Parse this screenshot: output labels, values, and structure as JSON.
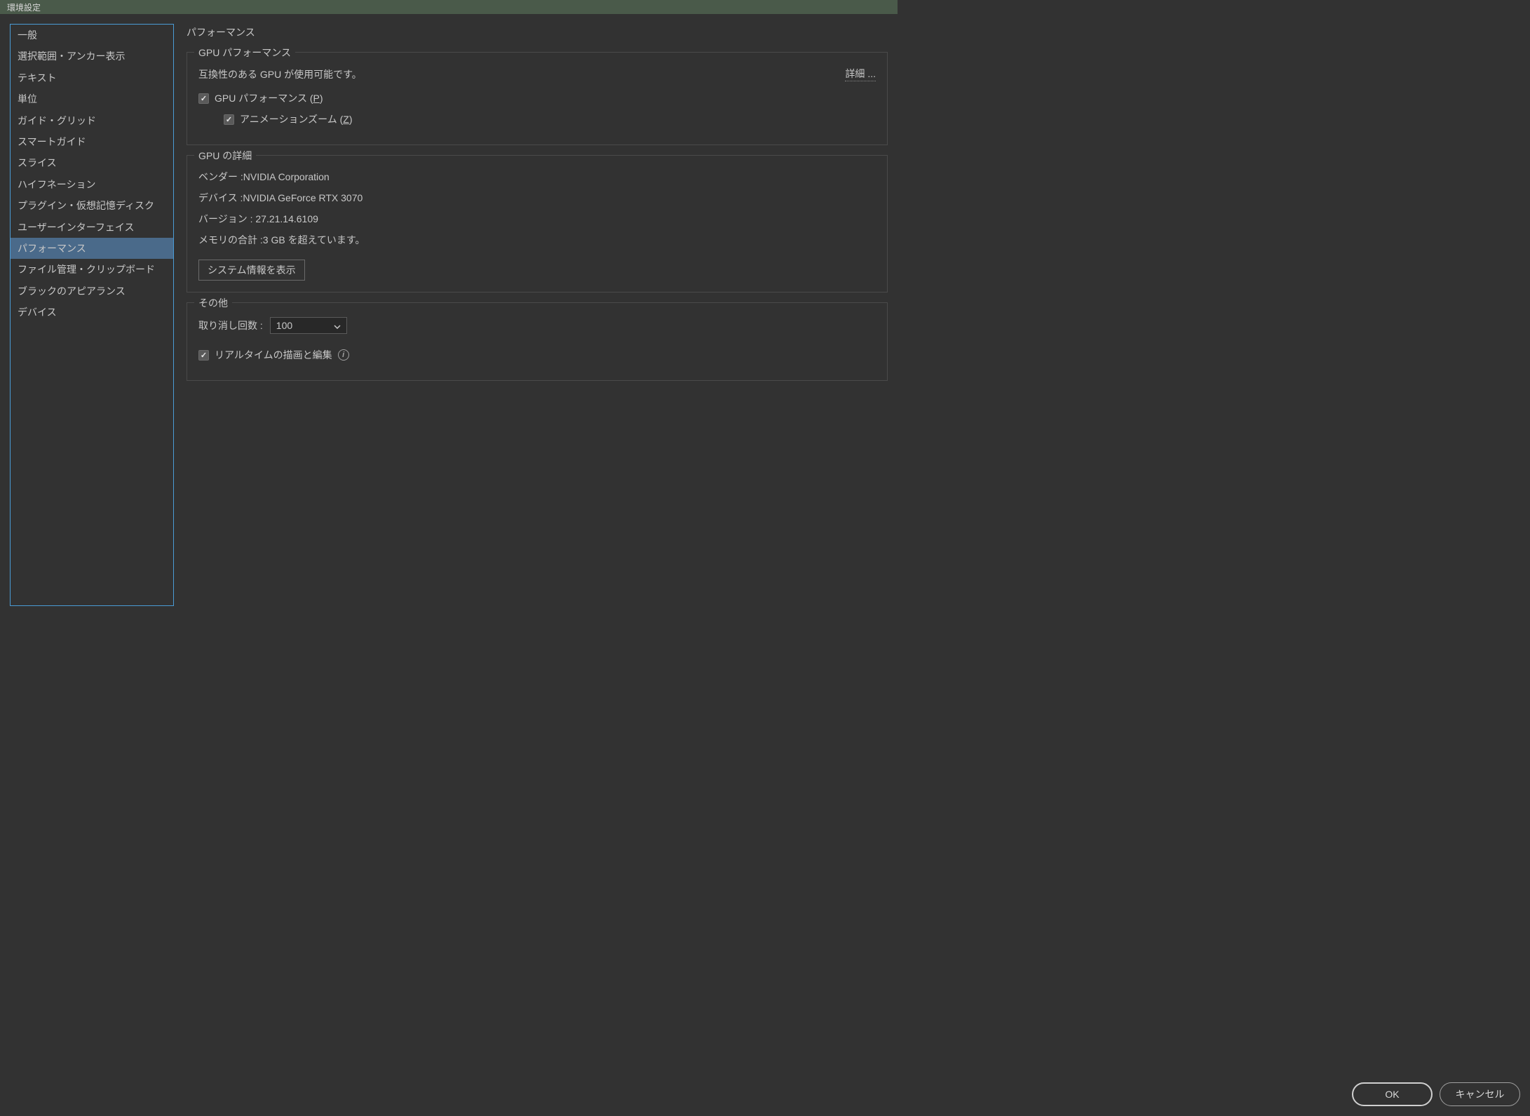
{
  "title_bar": "環境設定",
  "sidebar": {
    "items": [
      {
        "label": "一般"
      },
      {
        "label": "選択範囲・アンカー表示"
      },
      {
        "label": "テキスト"
      },
      {
        "label": "単位"
      },
      {
        "label": "ガイド・グリッド"
      },
      {
        "label": "スマートガイド"
      },
      {
        "label": "スライス"
      },
      {
        "label": "ハイフネーション"
      },
      {
        "label": "プラグイン・仮想記憶ディスク"
      },
      {
        "label": "ユーザーインターフェイス"
      },
      {
        "label": "パフォーマンス"
      },
      {
        "label": "ファイル管理・クリップボード"
      },
      {
        "label": "ブラックのアピアランス"
      },
      {
        "label": "デバイス"
      }
    ],
    "selected_index": 10
  },
  "main": {
    "page_title": "パフォーマンス",
    "gpu_perf": {
      "legend": "GPU パフォーマンス",
      "status": "互換性のある GPU が使用可能です。",
      "details_link": "詳細 ...",
      "gpu_checkbox_prefix": "GPU パフォーマンス (",
      "gpu_checkbox_key": "P",
      "gpu_checkbox_suffix": ")",
      "animzoom_prefix": "アニメーションズーム (",
      "animzoom_key": "Z",
      "animzoom_suffix": ")"
    },
    "gpu_details": {
      "legend": "GPU の詳細",
      "vendor": "ベンダー :NVIDIA Corporation",
      "device": "デバイス :NVIDIA GeForce RTX 3070",
      "version": "バージョン : 27.21.14.6109",
      "memory": "メモリの合計 :3 GB を超えています。",
      "sysinfo_btn": "システム情報を表示"
    },
    "other": {
      "legend": "その他",
      "undo_label": "取り消し回数 :",
      "undo_value": "100",
      "realtime_label": "リアルタイムの描画と編集"
    }
  },
  "footer": {
    "ok": "OK",
    "cancel": "キャンセル"
  }
}
